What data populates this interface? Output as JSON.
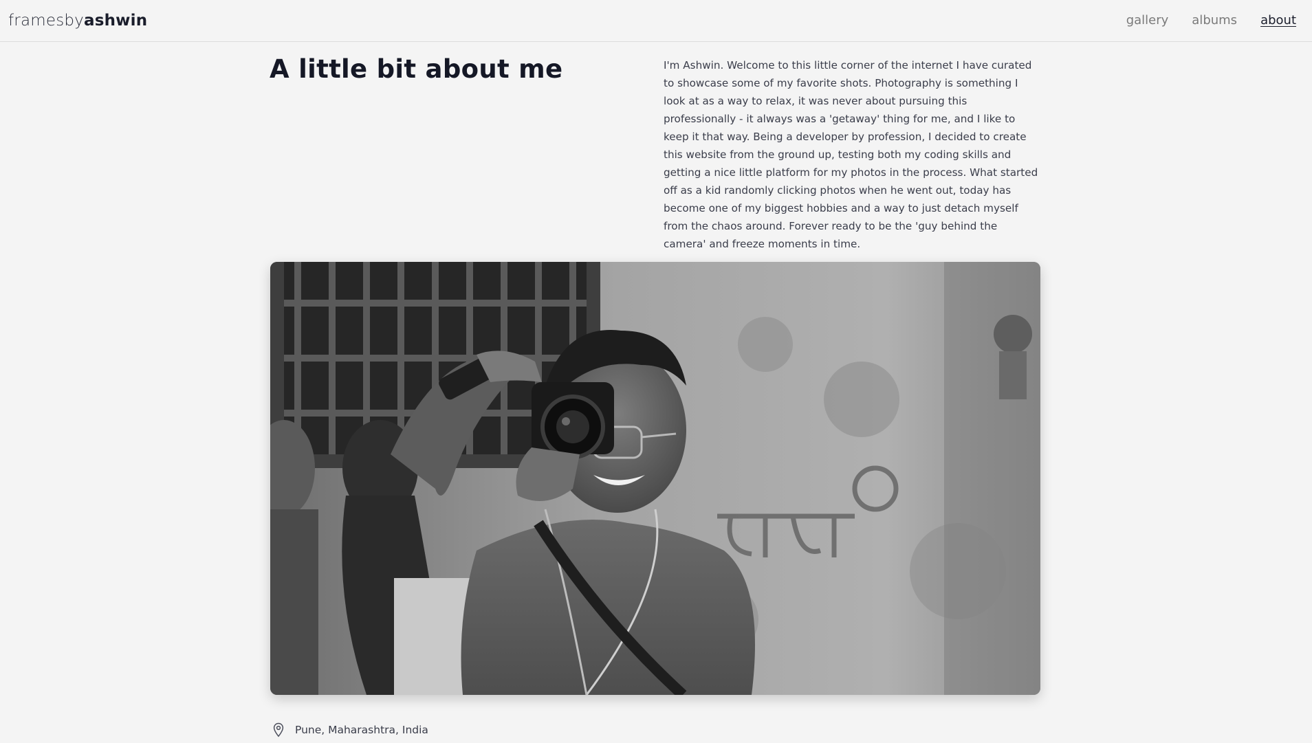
{
  "header": {
    "brand_light": "framesby",
    "brand_bold": "ashwin",
    "nav": [
      {
        "label": "gallery"
      },
      {
        "label": "albums"
      },
      {
        "label": "about"
      }
    ]
  },
  "about": {
    "title": "A little bit about me",
    "bio": "I'm Ashwin. Welcome to this little corner of the internet I have curated to showcase some of my favorite shots. Photography is something I look at as a way to relax, it was never about pursuing this professionally - it always was a 'getaway' thing for me, and I like to keep it that way. Being a developer by profession, I decided to create this website from the ground up, testing both my coding skills and getting a nice little platform for my photos in the process. What started off as a kid randomly clicking photos when he went out, today has become one of my biggest hobbies and a way to just detach myself from the chaos around. Forever ready to be the 'guy behind the camera' and freeze moments in time.",
    "photo_icon": "portrait-photo",
    "location_icon": "map-pin-icon",
    "location": "Pune, Maharashtra, India"
  }
}
